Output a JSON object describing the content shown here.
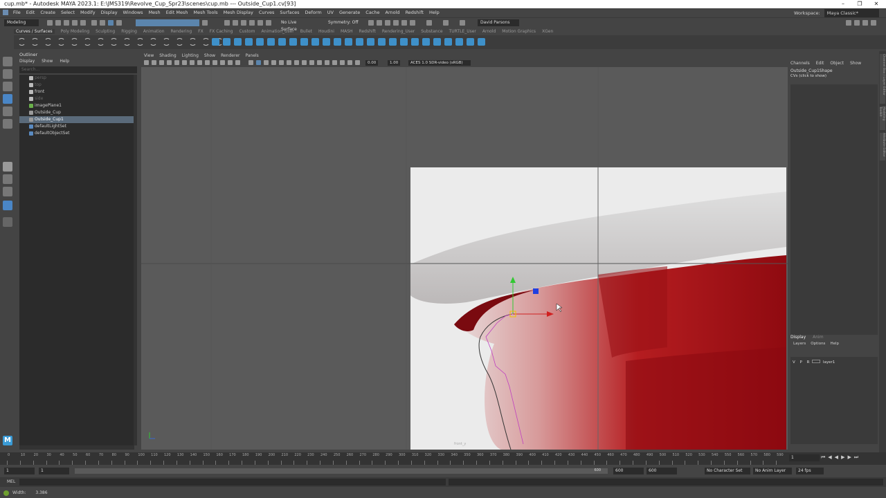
{
  "window": {
    "title": "cup.mb* - Autodesk MAYA 2023.1: E:\\JMS319\\Revolve_Cup_Spr23\\scenes\\cup.mb  ---  Outside_Cup1.cv[93]"
  },
  "menubar": {
    "items": [
      "File",
      "Edit",
      "Create",
      "Select",
      "Modify",
      "Display",
      "Windows",
      "Mesh",
      "Edit Mesh",
      "Mesh Tools",
      "Mesh Display",
      "Curves",
      "Surfaces",
      "Deform",
      "UV",
      "Generate",
      "Cache",
      "Arnold",
      "Redshift",
      "Help"
    ],
    "workspace_label": "Workspace:",
    "workspace_value": "Maya Classic*"
  },
  "statusline": {
    "mode": "Modeling",
    "live_surface": "No Live Surface",
    "symmetry": "Symmetry: Off",
    "user": "David Parsons"
  },
  "shelf": {
    "tabs": [
      "Curves / Surfaces",
      "Poly Modeling",
      "Sculpting",
      "Rigging",
      "Animation",
      "Rendering",
      "FX",
      "FX Caching",
      "Custom",
      "Animation_User",
      "Bullet",
      "Houdini",
      "MASH",
      "Redshift",
      "Rendering_User",
      "Substance",
      "TURTLE_User",
      "Arnold",
      "Motion Graphics",
      "XGen"
    ],
    "active_tab": "Curves / Surfaces"
  },
  "outliner": {
    "title": "Outliner",
    "menu": [
      "Display",
      "Show",
      "Help"
    ],
    "search_placeholder": "Search...",
    "items": [
      {
        "label": "persp",
        "icon": "camera-icon",
        "state": "dim"
      },
      {
        "label": "top",
        "icon": "camera-icon",
        "state": "dim"
      },
      {
        "label": "front",
        "icon": "camera-icon",
        "state": "normal"
      },
      {
        "label": "side",
        "icon": "camera-icon",
        "state": "dim"
      },
      {
        "label": "imagePlane1",
        "icon": "image-plane-icon",
        "state": "normal"
      },
      {
        "label": "Outside_Cup",
        "icon": "curve-icon",
        "state": "normal"
      },
      {
        "label": "Outside_Cup1",
        "icon": "curve-icon",
        "state": "selected"
      },
      {
        "label": "defaultLightSet",
        "icon": "set-icon",
        "state": "normal"
      },
      {
        "label": "defaultObjectSet",
        "icon": "set-icon",
        "state": "normal"
      }
    ]
  },
  "viewport": {
    "menu": [
      "View",
      "Shading",
      "Lighting",
      "Show",
      "Renderer",
      "Panels"
    ],
    "near_value": "0.00",
    "far_value": "1.00",
    "colorspace": "ACES 1.0 SDR-video (sRGB)",
    "image_label": "front_y"
  },
  "channelbox": {
    "menu": [
      "Channels",
      "Edit",
      "Object",
      "Show"
    ],
    "object_name": "Outside_Cup1Shape",
    "cvs_label": "CVs (click to show)",
    "layer_tabs": [
      "Display",
      "Anim"
    ],
    "layer_menu": [
      "Layers",
      "Options",
      "Help"
    ],
    "layer": {
      "v": "V",
      "p": "P",
      "r": "R",
      "name": "layer1"
    }
  },
  "sidetabs": [
    "Channel Box / Layer Editor",
    "Modeling Toolkit",
    "Attribute Editor"
  ],
  "timeslider": {
    "ticks": [
      "0",
      "10",
      "20",
      "30",
      "40",
      "50",
      "60",
      "70",
      "80",
      "90",
      "100",
      "110",
      "120",
      "130",
      "140",
      "150",
      "160",
      "170",
      "180",
      "190",
      "200",
      "210",
      "220",
      "230",
      "240",
      "250",
      "260",
      "270",
      "280",
      "290",
      "300",
      "310",
      "320",
      "330",
      "340",
      "350",
      "360",
      "370",
      "380",
      "390",
      "400",
      "410",
      "420",
      "430",
      "440",
      "450",
      "460",
      "470",
      "480",
      "490",
      "500",
      "510",
      "520",
      "530",
      "540",
      "550",
      "560",
      "570",
      "580",
      "590"
    ],
    "current_frame": "1"
  },
  "range": {
    "start": "1",
    "inner_start": "1",
    "inner_end": "600",
    "end1": "600",
    "end2": "600",
    "char_set": "No Character Set",
    "anim_layer": "No Anim Layer",
    "fps": "24 fps"
  },
  "cmdline": {
    "lang": "MEL"
  },
  "helpline": {
    "label": "Width:",
    "value": "3.386"
  }
}
